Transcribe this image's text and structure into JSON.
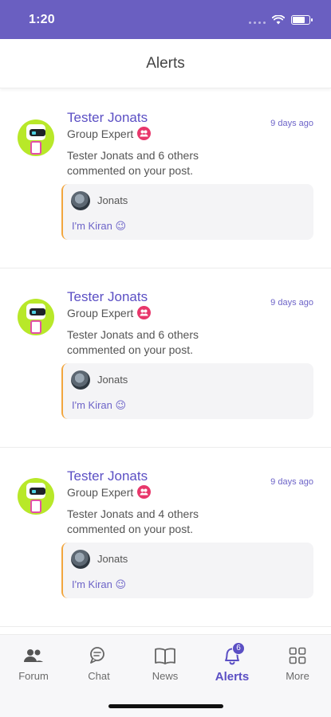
{
  "status_bar": {
    "time": "1:20"
  },
  "header": {
    "title": "Alerts"
  },
  "alerts": [
    {
      "name": "Tester Jonats",
      "role": "Group Expert",
      "time": "9 days ago",
      "message": "Tester Jonats and 6 others commented on your post.",
      "quote": {
        "user": "Jonats",
        "text": "I'm Kiran 😉"
      }
    },
    {
      "name": "Tester Jonats",
      "role": "Group Expert",
      "time": "9 days ago",
      "message": "Tester Jonats and 6 others commented on your post.",
      "quote": {
        "user": "Jonats",
        "text": "I'm Kiran 😉"
      }
    },
    {
      "name": "Tester Jonats",
      "role": "Group Expert",
      "time": "9 days ago",
      "message": "Tester Jonats and 4 others commented on your post.",
      "quote": {
        "user": "Jonats",
        "text": "I'm Kiran 😉"
      }
    }
  ],
  "tabbar": {
    "tabs": [
      {
        "label": "Forum",
        "icon": "people-icon"
      },
      {
        "label": "Chat",
        "icon": "chat-icon"
      },
      {
        "label": "News",
        "icon": "book-icon"
      },
      {
        "label": "Alerts",
        "icon": "bell-icon",
        "badge": "6",
        "active": true
      },
      {
        "label": "More",
        "icon": "grid-icon"
      }
    ]
  },
  "colors": {
    "status_bar": "#6a5fc1",
    "accent": "#5b4fc4",
    "quote_border": "#f2a63e",
    "role_badge": "#e8376b"
  }
}
